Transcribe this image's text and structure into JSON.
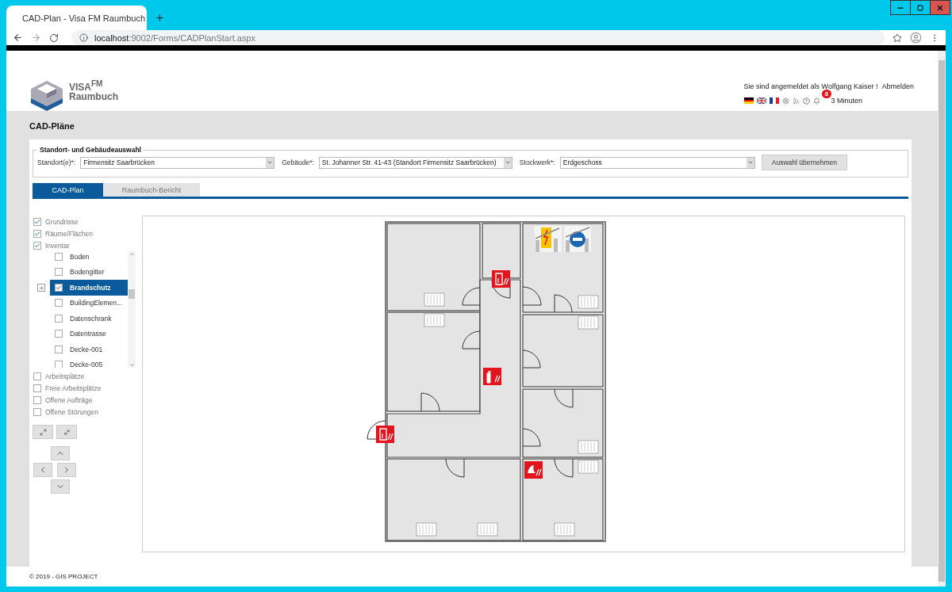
{
  "browser": {
    "tab_title": "CAD-Plan - Visa FM Raumbuch",
    "url_host": "localhost",
    "url_rest": ":9002/Forms/CADPlanStart.aspx"
  },
  "logo": {
    "brand": "VISA$^{FM}$",
    "subtitle": "Raumbuch"
  },
  "user_bar": {
    "text": "Sie sind angemeldet als Wolfgang Kaiser !",
    "logout": "Abmelden",
    "notification_count": "8",
    "session_time": "3 Minuten"
  },
  "page_title": "CAD-Pläne",
  "selection": {
    "legend": "Standort- und Gebäudeauswahl",
    "fields": [
      {
        "label": "Standort(e)*:",
        "value": "Firmensitz Saarbrücken"
      },
      {
        "label": "Gebäude*:",
        "value": "St. Johanner Str.  41-43 (Standort Firmensitz Saarbrücken)"
      },
      {
        "label": "Stockwerk*:",
        "value": "Erdgeschoss"
      }
    ],
    "button": "Auswahl übernehmen"
  },
  "tabs": [
    {
      "label": "CAD-Plan",
      "selected": true
    },
    {
      "label": "Raumbuch-Bericht",
      "selected": false
    }
  ],
  "layers_top": [
    {
      "label": "Grundrisse",
      "checked": true
    },
    {
      "label": "Räume/Flächen",
      "checked": true
    },
    {
      "label": "Inventar",
      "checked": true
    }
  ],
  "inventory": [
    {
      "label": "Boden",
      "checked": false,
      "selected": false,
      "expandable": false
    },
    {
      "label": "Bodengitter",
      "checked": false,
      "selected": false,
      "expandable": false
    },
    {
      "label": "Brandschutz",
      "checked": true,
      "selected": true,
      "expandable": true
    },
    {
      "label": "BuildingElemen...",
      "checked": false,
      "selected": false,
      "expandable": false
    },
    {
      "label": "Datenschrank",
      "checked": false,
      "selected": false,
      "expandable": false
    },
    {
      "label": "Datentrasse",
      "checked": false,
      "selected": false,
      "expandable": false
    },
    {
      "label": "Decke-001",
      "checked": false,
      "selected": false,
      "expandable": false
    },
    {
      "label": "Decke-005",
      "checked": false,
      "selected": false,
      "expandable": false
    }
  ],
  "layers_bottom": [
    {
      "label": "Arbeitsplätze",
      "checked": false
    },
    {
      "label": "Freie Arbeitsplätze",
      "checked": false
    },
    {
      "label": "Offene Aufträge",
      "checked": false
    },
    {
      "label": "Offene Störungen",
      "checked": false
    }
  ],
  "footer": "© 2019 - GIS PROJECT"
}
